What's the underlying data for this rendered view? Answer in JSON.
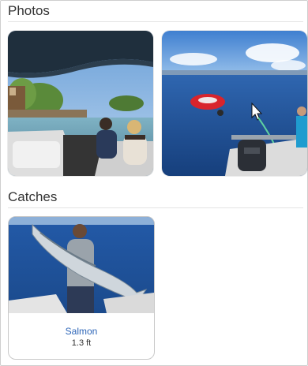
{
  "sections": {
    "photos_title": "Photos",
    "catches_title": "Catches"
  },
  "photos": [
    {
      "icon": "boat-lake-photo"
    },
    {
      "icon": "lake-float-photo"
    }
  ],
  "catches": [
    {
      "name": "Salmon",
      "size": "1.3 ft",
      "icon": "fish-catch-photo"
    }
  ],
  "colors": {
    "link": "#2e66b8",
    "water": "#1d4f9a",
    "sky": "#6fa4e0"
  }
}
